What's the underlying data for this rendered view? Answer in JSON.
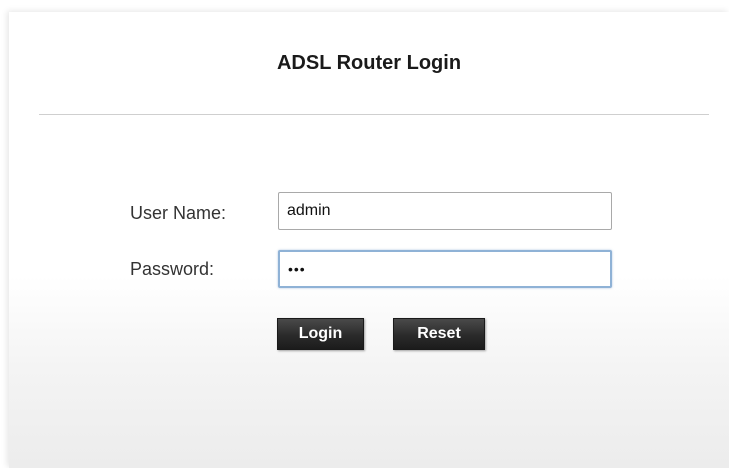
{
  "header": {
    "title": "ADSL Router Login"
  },
  "form": {
    "username_label": "User Name:",
    "username_value": "admin",
    "password_label": "Password:",
    "password_value": "abc",
    "login_label": "Login",
    "reset_label": "Reset"
  }
}
